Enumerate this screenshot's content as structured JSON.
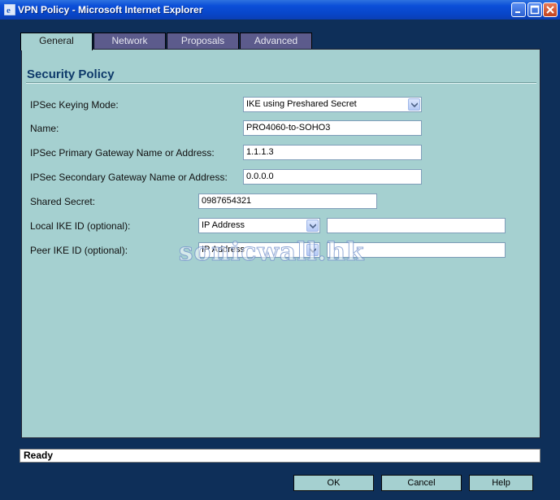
{
  "window": {
    "title": "VPN Policy - Microsoft Internet Explorer"
  },
  "tabs": [
    "General",
    "Network",
    "Proposals",
    "Advanced"
  ],
  "section_title": "Security Policy",
  "form": {
    "keying_mode": {
      "label": "IPSec Keying Mode:",
      "value": "IKE using Preshared Secret"
    },
    "name": {
      "label": "Name:",
      "value": "PRO4060-to-SOHO3"
    },
    "primary_gateway": {
      "label": "IPSec Primary Gateway Name or Address:",
      "value": "1.1.1.3"
    },
    "secondary_gateway": {
      "label": "IPSec Secondary Gateway Name or Address:",
      "value": "0.0.0.0"
    },
    "shared_secret": {
      "label": "Shared Secret:",
      "value": "0987654321"
    },
    "local_ike_id": {
      "label": "Local IKE ID (optional):",
      "type": "IP Address",
      "value": ""
    },
    "peer_ike_id": {
      "label": "Peer IKE ID (optional):",
      "type": "IP Address",
      "value": ""
    }
  },
  "watermark": "sonicwall.hk",
  "status": "Ready",
  "buttons": {
    "ok": "OK",
    "cancel": "Cancel",
    "help": "Help"
  }
}
